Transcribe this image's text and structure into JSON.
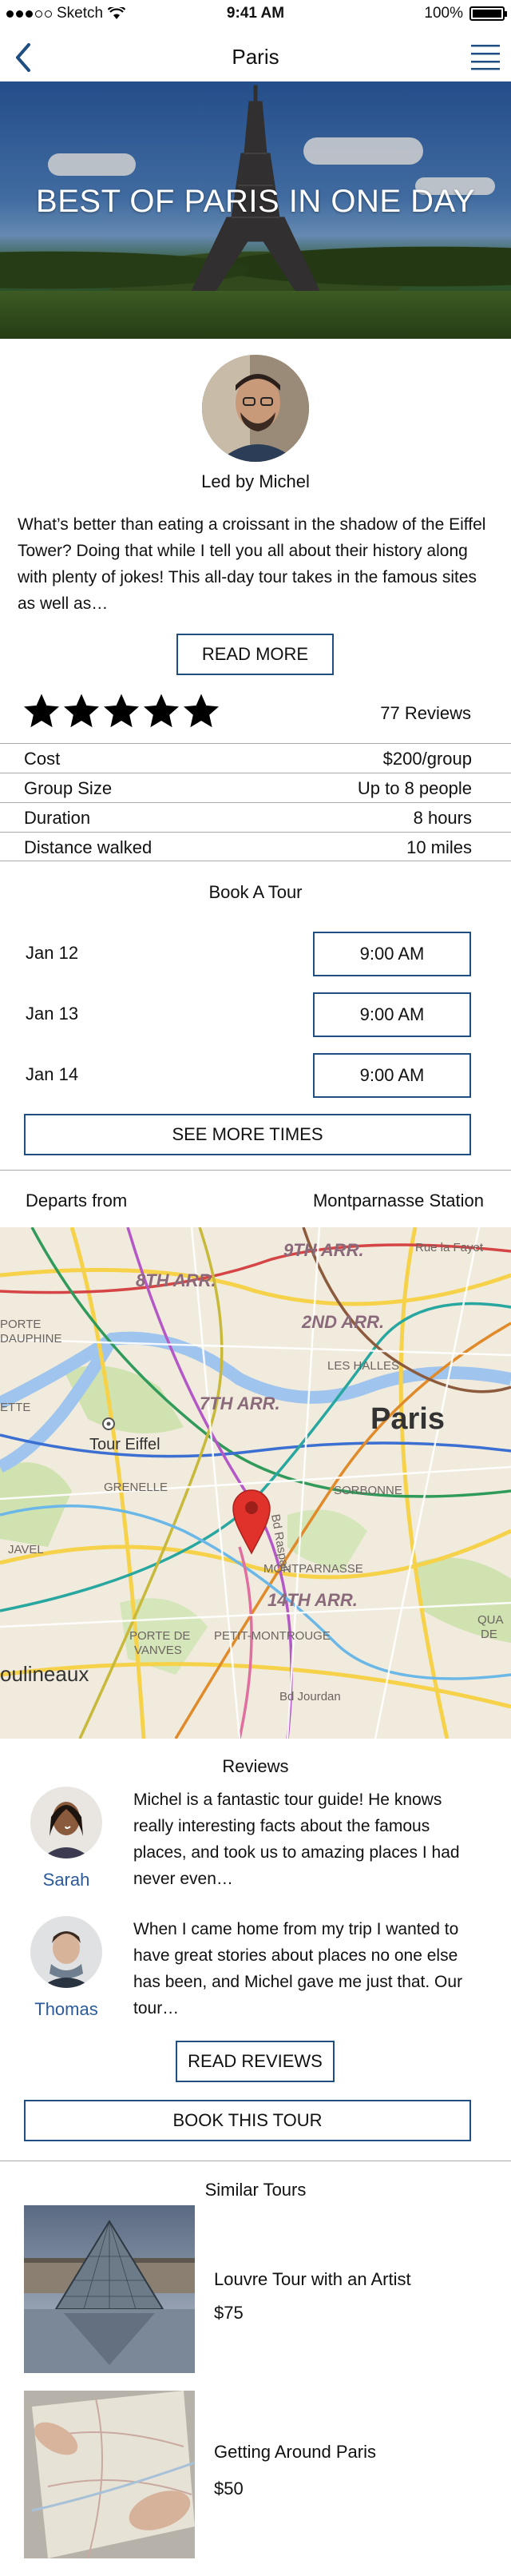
{
  "status_bar": {
    "carrier": "Sketch",
    "time": "9:41 AM",
    "battery": "100%"
  },
  "nav": {
    "title": "Paris"
  },
  "hero": {
    "title": "BEST OF PARIS IN ONE DAY"
  },
  "guide": {
    "name": "Led by Michel",
    "description": "What’s better than eating a croissant in the shadow of the Eiffel Tower? Doing that while I tell you all about their history along with plenty of jokes! This all-day tour takes in the famous sites as well as…",
    "read_more_label": "READ MORE"
  },
  "rating": {
    "stars": 5,
    "max_stars": 5,
    "reviews_label": "77 Reviews"
  },
  "details": [
    {
      "label": "Cost",
      "value": "$200/group"
    },
    {
      "label": "Group Size",
      "value": "Up to 8 people"
    },
    {
      "label": "Duration",
      "value": "8 hours"
    },
    {
      "label": "Distance walked",
      "value": "10 miles"
    }
  ],
  "booking": {
    "title": "Book A Tour",
    "slots": [
      {
        "date": "Jan 12",
        "time": "9:00 AM"
      },
      {
        "date": "Jan 13",
        "time": "9:00 AM"
      },
      {
        "date": "Jan 14",
        "time": "9:00 AM"
      }
    ],
    "see_more_label": "SEE MORE TIMES"
  },
  "departure": {
    "label": "Departs from",
    "location": "Montparnasse Station",
    "map_labels": {
      "arr9": "9TH ARR.",
      "arr8": "8TH ARR.",
      "rue": "Rue la Fayet",
      "arr2": "2ND ARR.",
      "porte": "PORTE",
      "dauphine": "DAUPHINE",
      "halles": "LES HALLES",
      "arr7": "7TH ARR.",
      "ette": "ETTE",
      "paris": "Paris",
      "tour_eiffel": "Tour Eiffel",
      "grenelle": "GRENELLE",
      "sorbonne": "SORBONNE",
      "raspail": "Bd Raspail",
      "javel": "JAVEL",
      "montparnasse": "MONTPARNASSE",
      "arr14": "14TH ARR.",
      "porte_vanves": "PORTE DE",
      "vanves": "VANVES",
      "petit": "PETIT-MONTROUGE",
      "moulineaux": "oulineaux",
      "jourdan": "Bd Jourdan",
      "qua": "QUA",
      "de": "DE"
    }
  },
  "reviews": {
    "title": "Reviews",
    "items": [
      {
        "name": "Sarah",
        "text": "Michel is a fantastic tour guide! He knows really interesting facts about the famous places, and took us to amazing places I had never even…"
      },
      {
        "name": "Thomas",
        "text": "When I came home from my trip I wanted to have great stories about places no one else has been, and Michel gave me just that. Our tour…"
      }
    ],
    "read_reviews_label": "READ REVIEWS",
    "book_label": "BOOK THIS TOUR"
  },
  "similar": {
    "title": "Similar Tours",
    "items": [
      {
        "name": "Louvre Tour with an Artist",
        "price": "$75"
      },
      {
        "name": "Getting Around Paris",
        "price": "$50"
      }
    ]
  },
  "colors": {
    "accent": "#1f4e82",
    "link": "#2b5b9a",
    "star": "#000000"
  }
}
